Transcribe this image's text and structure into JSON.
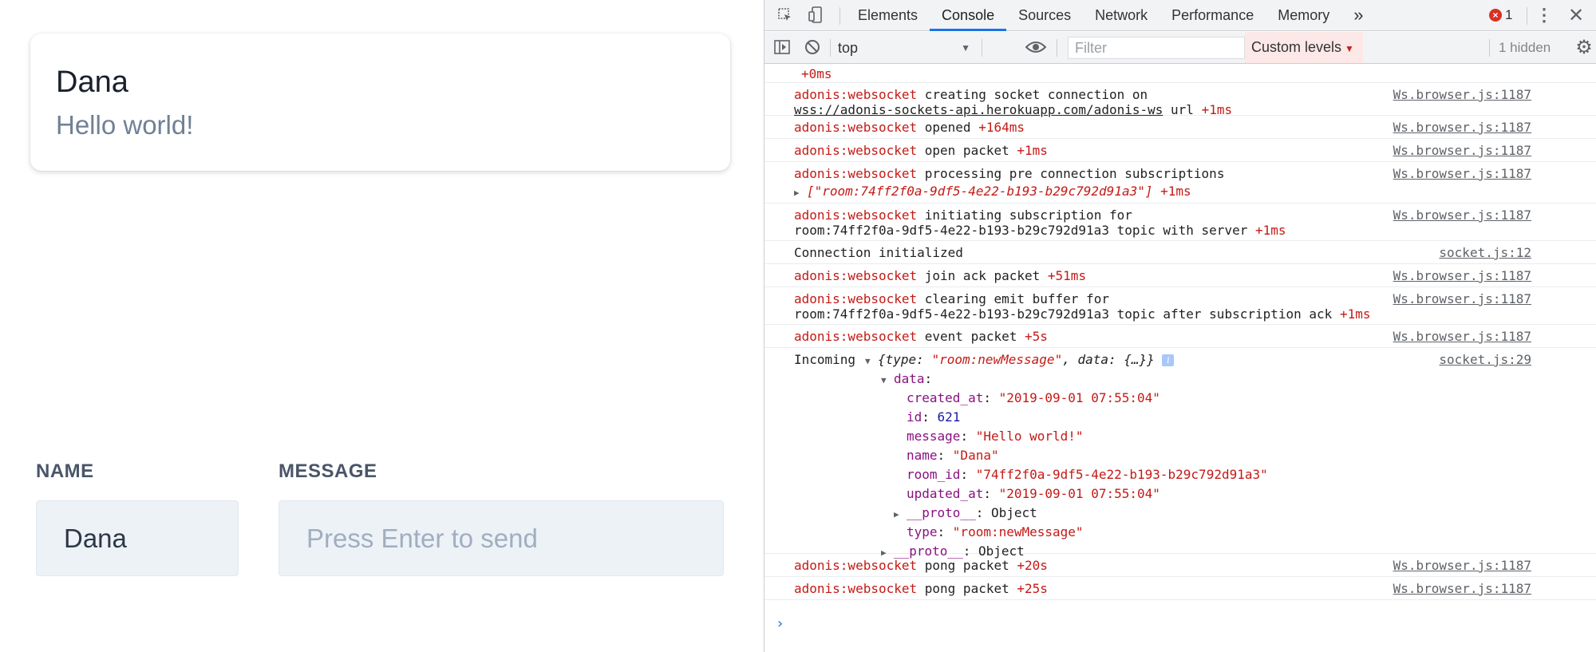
{
  "app": {
    "card": {
      "name": "Dana",
      "message": "Hello world!"
    },
    "form": {
      "name_label": "NAME",
      "message_label": "MESSAGE",
      "name_value": "Dana",
      "message_placeholder": "Press Enter to send"
    }
  },
  "devtools": {
    "tabs": [
      "Elements",
      "Console",
      "Sources",
      "Network",
      "Performance",
      "Memory"
    ],
    "active_tab": "Console",
    "more_tabs": "»",
    "error_count": "1",
    "toolbar": {
      "context": "top",
      "filter_placeholder": "Filter",
      "levels": "Custom levels",
      "hidden": "1 hidden"
    },
    "console": {
      "top_cut": "+0ms",
      "ns": "adonis:websocket",
      "src_ws": "Ws.browser.js:1187",
      "src_sock12": "socket.js:12",
      "src_sock29": "socket.js:29",
      "l1a": "creating socket connection on",
      "l1b": "wss://adonis-sockets-api.herokuapp.com/adonis-ws",
      "l1c": "url",
      "l1d": "+1ms",
      "l2a": "opened",
      "l2b": "+164ms",
      "l3a": "open packet",
      "l3b": "+1ms",
      "l4a": "processing pre connection subscriptions",
      "l4b": "[\"room:74ff2f0a-9df5-4e22-b193-b29c792d91a3\"]",
      "l4c": "+1ms",
      "l5a": "initiating subscription for",
      "l5b": "room:74ff2f0a-9df5-4e22-b193-b29c792d91a3 topic with server",
      "l5c": "+1ms",
      "l6": "Connection initialized",
      "l7a": "join ack packet",
      "l7b": "+51ms",
      "l8a": "clearing emit buffer for",
      "l8b": "room:74ff2f0a-9df5-4e22-b193-b29c792d91a3 topic after subscription ack",
      "l8c": "+1ms",
      "l9a": "event packet",
      "l9b": "+5s",
      "incoming": "Incoming",
      "obj_head_a": "{type: ",
      "obj_head_b": "\"room:newMessage\"",
      "obj_head_c": ", data: {…}}",
      "data_key": "data",
      "created_at_k": "created_at",
      "created_at_v": "\"2019-09-01 07:55:04\"",
      "id_k": "id",
      "id_v": "621",
      "message_k": "message",
      "message_v": "\"Hello world!\"",
      "name_k": "name",
      "name_v": "\"Dana\"",
      "room_id_k": "room_id",
      "room_id_v": "\"74ff2f0a-9df5-4e22-b193-b29c792d91a3\"",
      "updated_at_k": "updated_at",
      "updated_at_v": "\"2019-09-01 07:55:04\"",
      "proto_k": "__proto__",
      "proto_v": "Object",
      "type_k": "type",
      "type_v": "\"room:newMessage\"",
      "l10a": "pong packet",
      "l10b": "+20s",
      "l11a": "pong packet",
      "l11b": "+25s",
      "prompt": "›"
    }
  }
}
